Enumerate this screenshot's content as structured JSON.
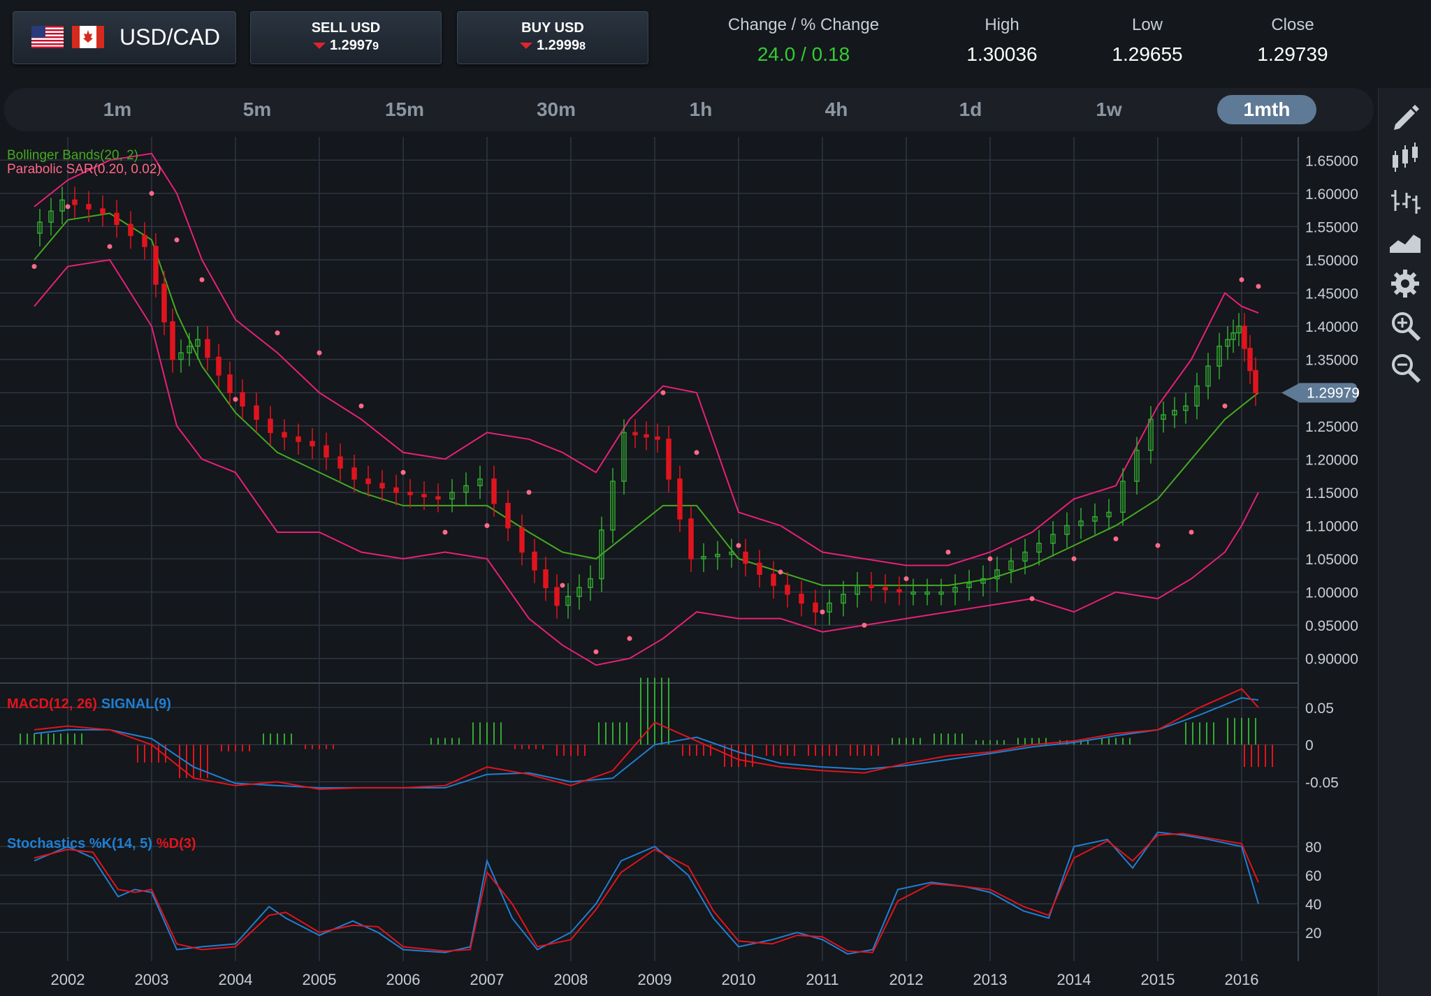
{
  "header": {
    "pair": "USD/CAD",
    "flags": [
      "us-flag-icon",
      "canada-flag-icon"
    ],
    "sell": {
      "label": "SELL USD",
      "price_main": "1.2997",
      "price_pip": "9"
    },
    "buy": {
      "label": "BUY USD",
      "price_main": "1.2999",
      "price_pip": "8"
    },
    "stats": [
      {
        "name": "change",
        "label": "Change / % Change",
        "value": "24.0 / 0.18"
      },
      {
        "name": "high",
        "label": "High",
        "value": "1.30036"
      },
      {
        "name": "low",
        "label": "Low",
        "value": "1.29655"
      },
      {
        "name": "close",
        "label": "Close",
        "value": "1.29739"
      }
    ]
  },
  "timeframes": [
    "1m",
    "5m",
    "15m",
    "30m",
    "1h",
    "4h",
    "1d",
    "1w",
    "1mth"
  ],
  "active_timeframe": "1mth",
  "sidebar_tools": [
    "pencil-icon",
    "candlestick-icon",
    "ohlc-bars-icon",
    "area-chart-icon",
    "gear-icon",
    "zoom-in-icon",
    "zoom-out-icon"
  ],
  "colors": {
    "up": "#33aa33",
    "down": "#e0141e",
    "bollinger_mid": "#44aa22",
    "bollinger_band": "#e8207a",
    "sar": "#ff6a8a",
    "macd": "#e0141e",
    "signal": "#1f7fd4",
    "stoch_k": "#1f7fd4",
    "stoch_d": "#e0141e",
    "grid": "#2e3642",
    "badge": "#5e7a96"
  },
  "chart_data": [
    {
      "type": "candlestick",
      "title": "",
      "indicators": [
        "Bollinger Bands(20, 2)",
        "Parabolic SAR(0.20, 0.02)"
      ],
      "current_price_label": "1.29979",
      "y_ticks": [
        "1.65000",
        "1.60000",
        "1.55000",
        "1.50000",
        "1.45000",
        "1.40000",
        "1.35000",
        "1.30000",
        "1.25000",
        "1.20000",
        "1.15000",
        "1.10000",
        "1.05000",
        "1.00000",
        "0.95000",
        "0.90000"
      ],
      "ylim": [
        0.865,
        1.685
      ],
      "x_tick_labels": [
        "2002",
        "2003",
        "2004",
        "2005",
        "2006",
        "2007",
        "2008",
        "2009",
        "2010",
        "2011",
        "2012",
        "2013",
        "2014",
        "2015",
        "2016"
      ],
      "x": [
        2001.6,
        2002.0,
        2002.5,
        2003.0,
        2003.3,
        2003.6,
        2004.0,
        2004.5,
        2005.0,
        2005.5,
        2006.0,
        2006.5,
        2007.0,
        2007.5,
        2007.9,
        2008.3,
        2008.7,
        2009.1,
        2009.5,
        2010.0,
        2010.5,
        2011.0,
        2011.5,
        2012.0,
        2012.5,
        2013.0,
        2013.5,
        2014.0,
        2014.5,
        2015.0,
        2015.4,
        2015.8,
        2016.0,
        2016.2
      ],
      "close": [
        1.54,
        1.59,
        1.57,
        1.52,
        1.35,
        1.38,
        1.3,
        1.24,
        1.22,
        1.17,
        1.15,
        1.14,
        1.17,
        1.06,
        0.98,
        1.02,
        1.24,
        1.23,
        1.05,
        1.06,
        1.01,
        0.97,
        1.01,
        1.0,
        1.0,
        1.02,
        1.06,
        1.1,
        1.12,
        1.26,
        1.28,
        1.37,
        1.4,
        1.3
      ],
      "bollinger_upper": [
        1.58,
        1.62,
        1.65,
        1.66,
        1.6,
        1.5,
        1.41,
        1.36,
        1.3,
        1.26,
        1.21,
        1.2,
        1.24,
        1.23,
        1.21,
        1.18,
        1.26,
        1.31,
        1.3,
        1.12,
        1.1,
        1.06,
        1.05,
        1.04,
        1.04,
        1.06,
        1.09,
        1.14,
        1.16,
        1.28,
        1.35,
        1.45,
        1.43,
        1.42
      ],
      "bollinger_middle": [
        1.5,
        1.56,
        1.57,
        1.53,
        1.42,
        1.34,
        1.27,
        1.21,
        1.18,
        1.15,
        1.13,
        1.13,
        1.13,
        1.09,
        1.06,
        1.05,
        1.09,
        1.13,
        1.13,
        1.05,
        1.03,
        1.01,
        1.01,
        1.01,
        1.01,
        1.02,
        1.04,
        1.07,
        1.1,
        1.14,
        1.2,
        1.26,
        1.28,
        1.3
      ],
      "bollinger_lower": [
        1.43,
        1.49,
        1.5,
        1.4,
        1.25,
        1.2,
        1.18,
        1.09,
        1.09,
        1.06,
        1.05,
        1.06,
        1.05,
        0.96,
        0.92,
        0.89,
        0.9,
        0.93,
        0.97,
        0.96,
        0.96,
        0.94,
        0.95,
        0.96,
        0.97,
        0.98,
        0.99,
        0.97,
        1.0,
        0.99,
        1.02,
        1.06,
        1.1,
        1.15
      ],
      "parabolic_sar": [
        1.49,
        1.58,
        1.52,
        1.6,
        1.53,
        1.47,
        1.29,
        1.39,
        1.36,
        1.28,
        1.18,
        1.09,
        1.1,
        1.15,
        1.01,
        0.91,
        0.93,
        1.3,
        1.21,
        1.07,
        1.03,
        0.97,
        0.95,
        1.02,
        1.06,
        1.05,
        0.99,
        1.05,
        1.08,
        1.07,
        1.09,
        1.28,
        1.47,
        1.46
      ]
    },
    {
      "type": "line",
      "title": "",
      "indicator": "MACD(12, 26)",
      "signal_label": "SIGNAL(9)",
      "y_ticks": [
        "0.05",
        "0",
        "-0.05"
      ],
      "ylim": [
        -0.075,
        0.08
      ],
      "x": [
        2001.6,
        2002.0,
        2002.5,
        2003.0,
        2003.5,
        2004.0,
        2004.5,
        2005.0,
        2005.5,
        2006.0,
        2006.5,
        2007.0,
        2007.5,
        2008.0,
        2008.5,
        2009.0,
        2009.5,
        2010.0,
        2010.5,
        2011.0,
        2011.5,
        2012.0,
        2012.5,
        2013.0,
        2013.5,
        2014.0,
        2014.5,
        2015.0,
        2015.5,
        2016.0,
        2016.2
      ],
      "series": [
        {
          "name": "MACD(12, 26)",
          "values": [
            0.02,
            0.025,
            0.02,
            0.0,
            -0.045,
            -0.055,
            -0.05,
            -0.06,
            -0.058,
            -0.058,
            -0.055,
            -0.03,
            -0.04,
            -0.055,
            -0.035,
            0.03,
            0.005,
            -0.02,
            -0.03,
            -0.035,
            -0.038,
            -0.025,
            -0.015,
            -0.01,
            0.0,
            0.005,
            0.015,
            0.02,
            0.05,
            0.075,
            0.05
          ]
        },
        {
          "name": "SIGNAL(9)",
          "values": [
            0.015,
            0.02,
            0.02,
            0.008,
            -0.03,
            -0.052,
            -0.055,
            -0.058,
            -0.058,
            -0.058,
            -0.058,
            -0.04,
            -0.038,
            -0.05,
            -0.045,
            0.0,
            0.01,
            -0.01,
            -0.025,
            -0.03,
            -0.033,
            -0.028,
            -0.02,
            -0.012,
            -0.003,
            0.003,
            0.012,
            0.02,
            0.04,
            0.063,
            0.06
          ]
        }
      ]
    },
    {
      "type": "line",
      "title": "",
      "indicator": "Stochastics %K(14, 5)",
      "d_label": "%D(3)",
      "y_ticks": [
        "80",
        "60",
        "40",
        "20"
      ],
      "ylim": [
        0,
        100
      ],
      "x": [
        2001.6,
        2002.0,
        2002.3,
        2002.6,
        2002.8,
        2003.0,
        2003.3,
        2003.6,
        2004.0,
        2004.4,
        2004.6,
        2005.0,
        2005.4,
        2005.7,
        2006.0,
        2006.5,
        2006.8,
        2007.0,
        2007.3,
        2007.6,
        2008.0,
        2008.3,
        2008.6,
        2009.0,
        2009.4,
        2009.7,
        2010.0,
        2010.4,
        2010.7,
        2011.0,
        2011.3,
        2011.6,
        2011.9,
        2012.3,
        2012.7,
        2013.0,
        2013.4,
        2013.7,
        2014.0,
        2014.4,
        2014.7,
        2015.0,
        2015.3,
        2015.6,
        2016.0,
        2016.2
      ],
      "series": [
        {
          "name": "%K(14, 5)",
          "values": [
            70,
            80,
            72,
            45,
            50,
            48,
            8,
            10,
            12,
            38,
            30,
            18,
            28,
            20,
            8,
            6,
            10,
            70,
            30,
            8,
            20,
            40,
            70,
            80,
            60,
            30,
            10,
            15,
            20,
            15,
            5,
            8,
            50,
            55,
            52,
            48,
            35,
            30,
            80,
            85,
            65,
            90,
            88,
            85,
            80,
            40
          ]
        },
        {
          "name": "%D(3)",
          "values": [
            72,
            78,
            76,
            50,
            48,
            50,
            12,
            8,
            10,
            32,
            34,
            20,
            25,
            24,
            10,
            7,
            8,
            62,
            40,
            10,
            15,
            36,
            62,
            78,
            66,
            35,
            14,
            12,
            18,
            17,
            7,
            6,
            42,
            54,
            52,
            50,
            38,
            32,
            72,
            84,
            70,
            88,
            89,
            86,
            82,
            55
          ]
        }
      ]
    }
  ]
}
